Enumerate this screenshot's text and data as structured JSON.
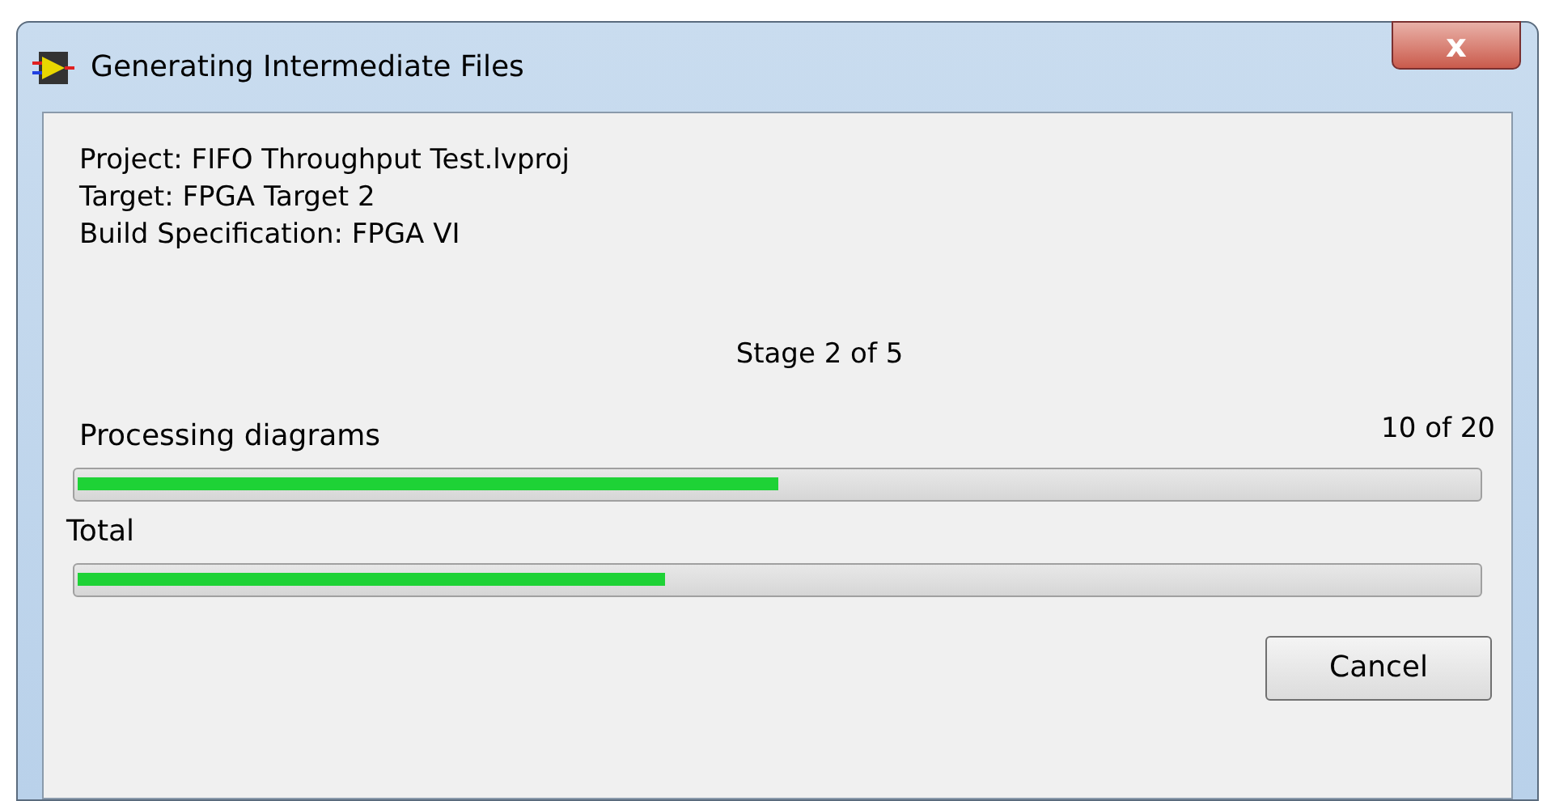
{
  "window": {
    "title": "Generating Intermediate Files",
    "close": "x"
  },
  "info": [
    "Project: FIFO Throughput Test.lvproj",
    "Target: FPGA Target 2",
    "Build Specification: FPGA VI"
  ],
  "stage": "Stage 2 of 5",
  "progress": [
    {
      "label": "Processing diagrams",
      "count": "10 of 20",
      "level": 0.5
    },
    {
      "label": "Total",
      "level": 0.42
    }
  ],
  "buttons": [
    "Cancel"
  ]
}
